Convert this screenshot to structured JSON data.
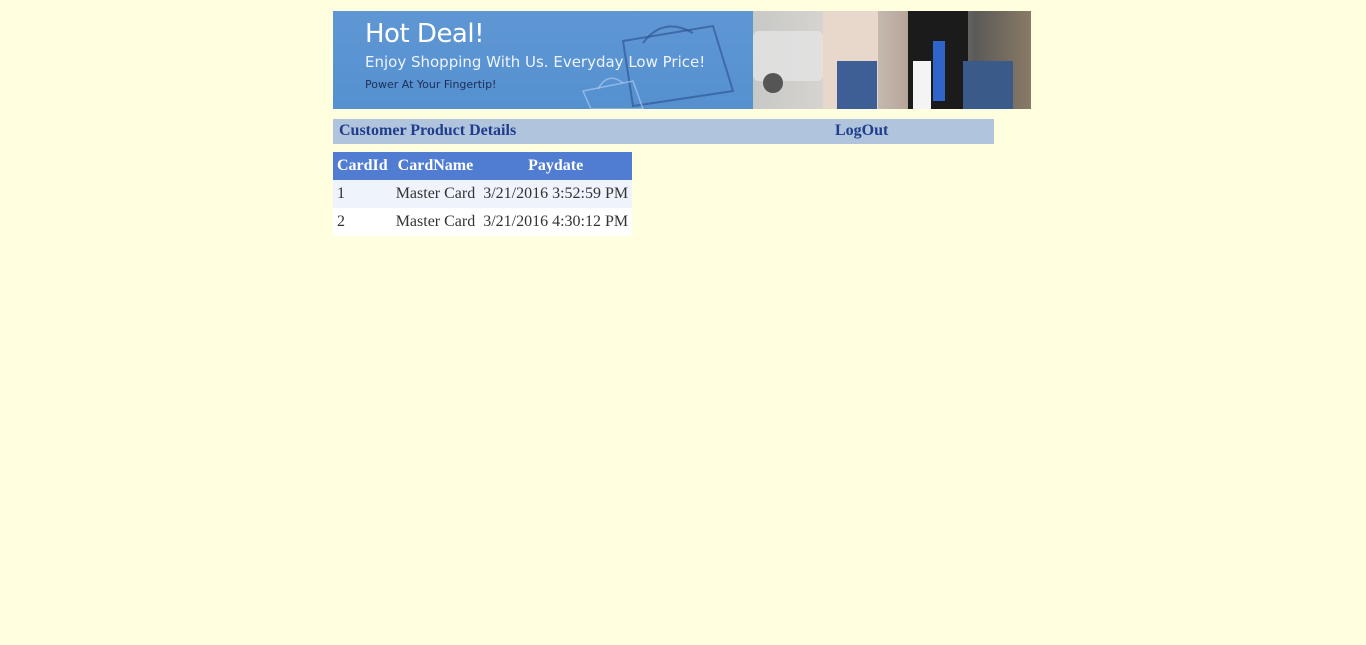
{
  "banner": {
    "title": "Hot Deal!",
    "subtitle": "Enjoy Shopping With Us. Everyday Low Price!",
    "tagline": "Power At Your Fingertip!"
  },
  "header": {
    "title": "Customer Product Details",
    "logout_label": "LogOut"
  },
  "table": {
    "columns": [
      "CardId",
      "CardName",
      "Paydate"
    ],
    "rows": [
      [
        "1",
        "Master Card",
        "3/21/2016 3:52:59 PM"
      ],
      [
        "2",
        "Master Card",
        "3/21/2016 4:30:12 PM"
      ]
    ]
  },
  "colors": {
    "page_bg": "#ffffe0",
    "titlebar_bg": "#b0c4de",
    "header_text": "#1f3d8a",
    "table_header_bg": "#507cd1",
    "row_alt_bg": "#eff3fb"
  }
}
